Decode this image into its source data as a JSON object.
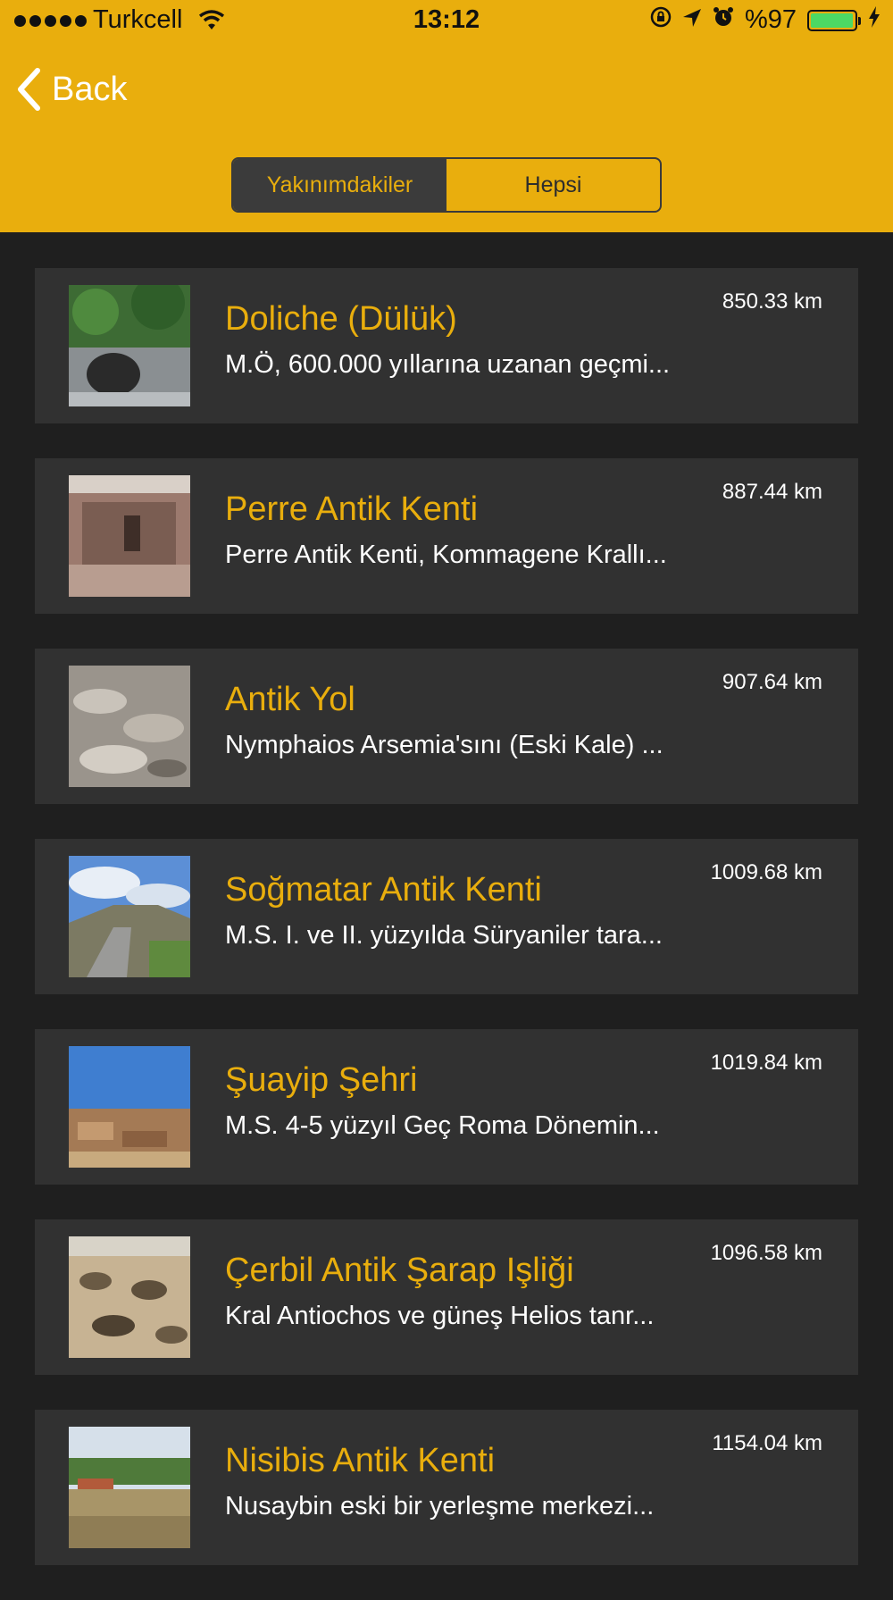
{
  "status_bar": {
    "carrier": "Turkcell",
    "time": "13:12",
    "battery_text": "%97",
    "battery_level": 0.97,
    "signal_icon": "signal-dots-icon",
    "wifi_icon": "wifi-icon",
    "icons_right": [
      "orientation-lock-icon",
      "location-arrow-icon",
      "alarm-clock-icon",
      "charging-bolt-icon"
    ]
  },
  "nav": {
    "back_label": "Back",
    "back_icon": "chevron-left-icon"
  },
  "segments": [
    {
      "label": "Yakınımdakiler",
      "selected": true
    },
    {
      "label": "Hepsi",
      "selected": false
    }
  ],
  "colors": {
    "accent": "#e9ae0d",
    "background": "#1f1f1f",
    "card": "#313131",
    "segment_active": "#3b3b3b"
  },
  "places": [
    {
      "title": "Doliche (Dülük)",
      "description": "M.Ö, 600.000 yıllarına uzanan geçmi...",
      "distance": "850.33 km"
    },
    {
      "title": "Perre Antik Kenti",
      "description": "Perre Antik Kenti, Kommagene Krallı...",
      "distance": "887.44 km"
    },
    {
      "title": "Antik Yol",
      "description": "Nymphaios Arsemia'sını (Eski Kale) ...",
      "distance": "907.64 km"
    },
    {
      "title": "Soğmatar Antik Kenti",
      "description": "M.S. I. ve II. yüzyılda Süryaniler tara...",
      "distance": "1009.68 km"
    },
    {
      "title": "Şuayip Şehri",
      "description": "M.S. 4-5 yüzyıl Geç Roma Dönemin...",
      "distance": "1019.84 km"
    },
    {
      "title": "Çerbil Antik Şarap Işliği",
      "description": "Kral Antiochos ve güneş Helios tanr...",
      "distance": "1096.58 km"
    },
    {
      "title": "Nisibis Antik Kenti",
      "description": "Nusaybin eski bir yerleşme merkezi...",
      "distance": "1154.04 km"
    }
  ]
}
